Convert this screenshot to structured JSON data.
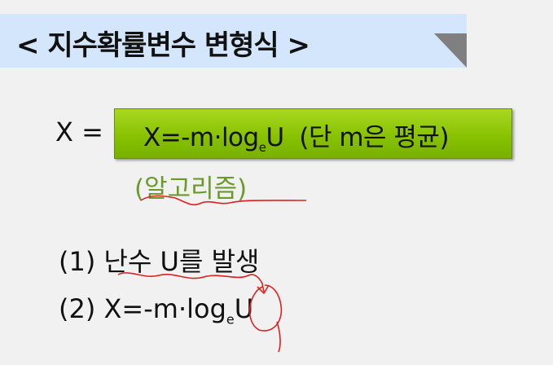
{
  "title": "< 지수확률변수 변형식 >",
  "equation_lhs": "X =",
  "formula": {
    "main": "X=-m·log",
    "sub": "e",
    "tail": "U",
    "note": "(단 m은 평균)"
  },
  "algorithm_label": "(알고리즘)",
  "steps": [
    {
      "num": "(1)",
      "text": "난수 U를 발생"
    },
    {
      "num": "(2)",
      "main": "X=-m·log",
      "sub": "e",
      "tail": "U"
    }
  ],
  "colors": {
    "title_bg": "#d3e6fb",
    "box": "#94cc10",
    "algo_text": "#6a9a2a",
    "ink": "#e02020"
  }
}
